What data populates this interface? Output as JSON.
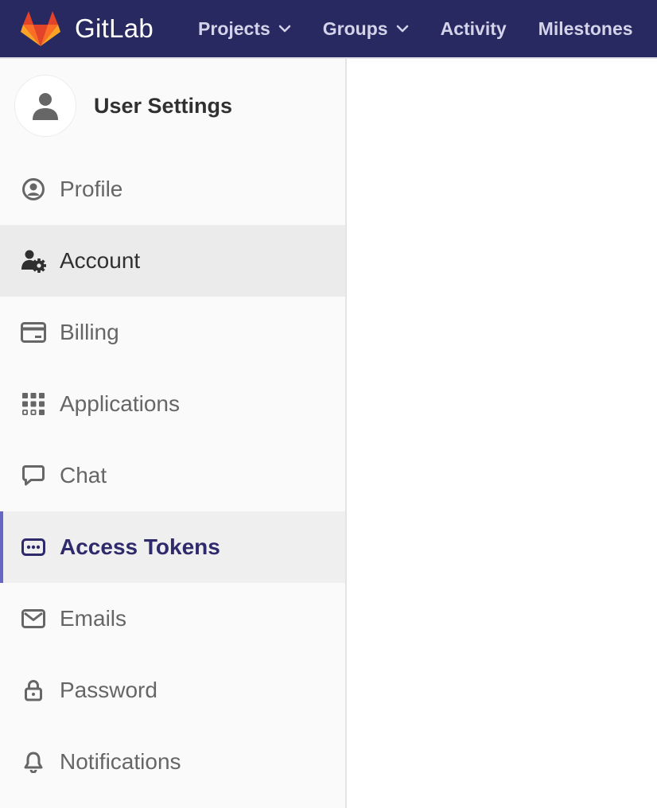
{
  "header": {
    "brand_name": "GitLab",
    "nav": [
      {
        "label": "Projects",
        "has_dropdown": true
      },
      {
        "label": "Groups",
        "has_dropdown": true
      },
      {
        "label": "Activity",
        "has_dropdown": false
      },
      {
        "label": "Milestones",
        "has_dropdown": false
      }
    ],
    "colors": {
      "background": "#292961",
      "nav_text": "#d3d3e9"
    }
  },
  "sidebar": {
    "context_title": "User Settings",
    "avatar_icon": "user-icon",
    "items": [
      {
        "label": "Profile",
        "icon": "profile-icon",
        "state": "normal"
      },
      {
        "label": "Account",
        "icon": "account-icon",
        "state": "hover"
      },
      {
        "label": "Billing",
        "icon": "credit-card-icon",
        "state": "normal"
      },
      {
        "label": "Applications",
        "icon": "applications-icon",
        "state": "normal"
      },
      {
        "label": "Chat",
        "icon": "comment-icon",
        "state": "normal"
      },
      {
        "label": "Access Tokens",
        "icon": "token-icon",
        "state": "active"
      },
      {
        "label": "Emails",
        "icon": "mail-icon",
        "state": "normal"
      },
      {
        "label": "Password",
        "icon": "lock-icon",
        "state": "normal"
      },
      {
        "label": "Notifications",
        "icon": "notifications-icon",
        "state": "normal"
      }
    ],
    "colors": {
      "active_text": "#2f2a6b",
      "active_indicator": "#6666c4"
    }
  }
}
